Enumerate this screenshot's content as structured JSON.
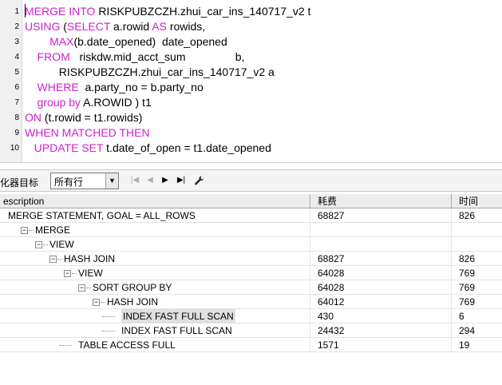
{
  "editor": {
    "lines": [
      {
        "num": "1",
        "segments": [
          {
            "t": "MERGE INTO ",
            "k": true
          },
          {
            "t": "RISKPUBZCZH.zhui_car_ins_140717_v2 t",
            "k": false
          }
        ]
      },
      {
        "num": "2",
        "segments": [
          {
            "t": "USING ",
            "k": true
          },
          {
            "t": "(",
            "k": false
          },
          {
            "t": "SELECT ",
            "k": true
          },
          {
            "t": "a.rowid ",
            "k": false
          },
          {
            "t": "AS ",
            "k": true
          },
          {
            "t": "rowids,",
            "k": false
          }
        ]
      },
      {
        "num": "3",
        "segments": [
          {
            "t": "        MAX",
            "k": true
          },
          {
            "t": "(b.date_opened)  date_opened",
            "k": false
          }
        ]
      },
      {
        "num": "4",
        "segments": [
          {
            "t": "    FROM  ",
            "k": true
          },
          {
            "t": " riskdw.mid_acct_sum                b,",
            "k": false
          }
        ]
      },
      {
        "num": "5",
        "segments": [
          {
            "t": "           RISKPUBZCZH.zhui_car_ins_140717_v2 a",
            "k": false
          }
        ]
      },
      {
        "num": "6",
        "segments": [
          {
            "t": "    WHERE ",
            "k": true
          },
          {
            "t": " a.party_no = b.party_no",
            "k": false
          }
        ]
      },
      {
        "num": "7",
        "segments": [
          {
            "t": "    group by ",
            "k": true
          },
          {
            "t": "A.ROWID ) t1",
            "k": false
          }
        ]
      },
      {
        "num": "8",
        "segments": [
          {
            "t": "ON ",
            "k": true
          },
          {
            "t": "(t.rowid = t1.rowids)",
            "k": false
          }
        ]
      },
      {
        "num": "9",
        "segments": [
          {
            "t": "WHEN MATCHED THEN",
            "k": true
          }
        ]
      },
      {
        "num": "10",
        "segments": [
          {
            "t": "   UPDATE SET ",
            "k": true
          },
          {
            "t": "t.date_of_open = t1.date_opened",
            "k": false
          }
        ]
      }
    ]
  },
  "toolbar": {
    "label": "化器目标",
    "select_value": "所有行",
    "select_arrow": "▼",
    "btn_first": "|◀",
    "btn_prev": "◀",
    "btn_next": "▶",
    "btn_last": "▶|",
    "wrench_icon": "wrench-icon"
  },
  "grid": {
    "headers": {
      "operation": "escription",
      "cost": "耗费",
      "time": "时间"
    },
    "rows": [
      {
        "label": "MERGE STATEMENT, GOAL = ALL_ROWS",
        "level": 0,
        "expander": "",
        "cost": "68827",
        "time": "826",
        "selected": false
      },
      {
        "label": "MERGE",
        "level": 1,
        "expander": "−",
        "cost": "",
        "time": "",
        "selected": false
      },
      {
        "label": "VIEW",
        "level": 2,
        "expander": "−",
        "cost": "",
        "time": "",
        "selected": false
      },
      {
        "label": "HASH JOIN",
        "level": 3,
        "expander": "−",
        "cost": "68827",
        "time": "826",
        "selected": false
      },
      {
        "label": "VIEW",
        "level": 4,
        "expander": "−",
        "cost": "64028",
        "time": "769",
        "selected": false
      },
      {
        "label": "SORT GROUP BY",
        "level": 5,
        "expander": "−",
        "cost": "64028",
        "time": "769",
        "selected": false
      },
      {
        "label": "HASH JOIN",
        "level": 6,
        "expander": "−",
        "cost": "64012",
        "time": "769",
        "selected": false
      },
      {
        "label": "INDEX FAST FULL SCAN",
        "level": 7,
        "expander": "",
        "cost": "430",
        "time": "6",
        "selected": true
      },
      {
        "label": "INDEX FAST FULL SCAN",
        "level": 7,
        "expander": "",
        "cost": "24432",
        "time": "294",
        "selected": false
      },
      {
        "label": "TABLE ACCESS FULL",
        "level": 4,
        "expander": "",
        "cost": "1571",
        "time": "19",
        "selected": false
      }
    ]
  }
}
